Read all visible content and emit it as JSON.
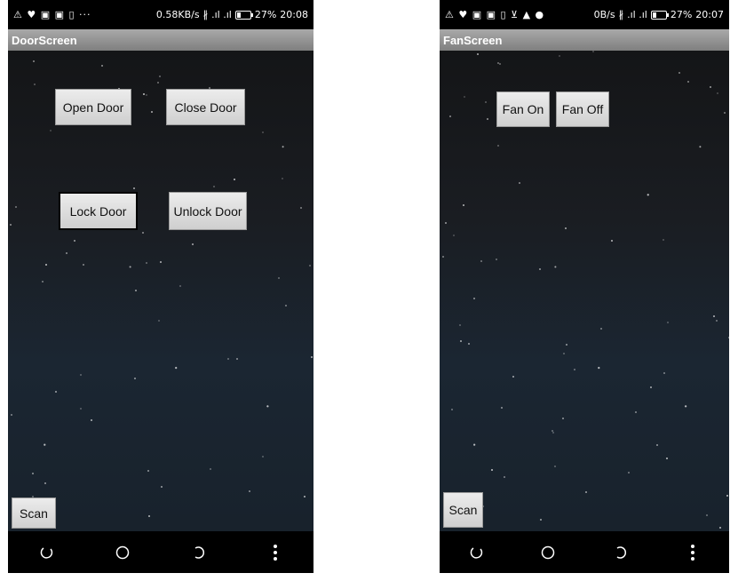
{
  "left": {
    "status": {
      "icons": "⚠ ♥ ▣ ▣ ▯ ···",
      "speed": "0.58KB/s",
      "bluetooth": "∦",
      "signal": ".ıl .ıl",
      "battery": "27%",
      "time": "20:08"
    },
    "title": "DoorScreen",
    "buttons": {
      "open": "Open Door",
      "close": "Close Door",
      "lock": "Lock Door",
      "unlock": "Unlock Door",
      "scan": "Scan"
    }
  },
  "right": {
    "status": {
      "icons": "⚠ ♥ ▣ ▣ ▯ ⊻ ▲ ●",
      "speed": "0B/s",
      "bluetooth": "∦",
      "signal": ".ıl .ıl",
      "battery": "27%",
      "time": "20:07"
    },
    "title": "FanScreen",
    "buttons": {
      "fan_on": "Fan On",
      "fan_off": "Fan Off",
      "scan": "Scan"
    }
  },
  "nav_icons": [
    "back-icon",
    "home-icon",
    "recents-icon",
    "menu-icon"
  ],
  "colors": {
    "titlebar": "#8f8f8f",
    "button": "#e0e0e0",
    "sky_top": "#141517",
    "sky_bottom": "#1b2632"
  }
}
